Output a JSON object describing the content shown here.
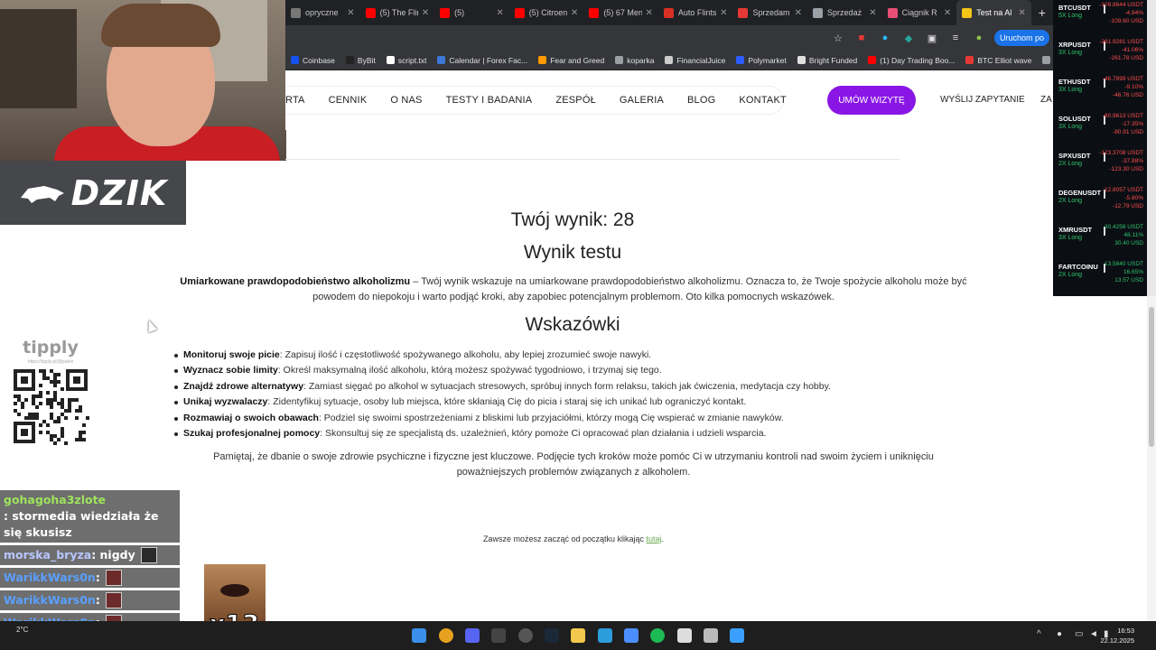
{
  "browser": {
    "tabs": [
      {
        "label": "opryczne",
        "color": "#777777"
      },
      {
        "label": "(5) The Flin",
        "color": "#ff0000"
      },
      {
        "label": "(5)",
        "color": "#ff0000"
      },
      {
        "label": "(5) Citroen",
        "color": "#ff0000"
      },
      {
        "label": "(5) 67 Men",
        "color": "#ff0000"
      },
      {
        "label": "Auto Flints",
        "color": "#d93025"
      },
      {
        "label": "Sprzedam",
        "color": "#e53935"
      },
      {
        "label": "Sprzedaż",
        "color": "#9aa0a6"
      },
      {
        "label": "Ciągnik R",
        "color": "#e94e77"
      },
      {
        "label": "Test na Al",
        "color": "#f5c518"
      }
    ],
    "active_tab_index": 9,
    "new_tab": "+",
    "launch_button": "Uruchom po",
    "bookmarks": [
      {
        "label": "Coinbase",
        "color": "#1652f0"
      },
      {
        "label": "ByBit",
        "color": "#222222"
      },
      {
        "label": "script.txt",
        "color": "#ffffff"
      },
      {
        "label": "Calendar | Forex Fac...",
        "color": "#3c78d8"
      },
      {
        "label": "Fear and Greed",
        "color": "#ff9900"
      },
      {
        "label": "koparka",
        "color": "#9aa0a6"
      },
      {
        "label": "FinancialJuice",
        "color": "#cccccc"
      },
      {
        "label": "Polymarket",
        "color": "#2d5bff"
      },
      {
        "label": "Bright Funded",
        "color": "#e0e0e0"
      },
      {
        "label": "(1) Day Trading Boo...",
        "color": "#ff0000"
      },
      {
        "label": "BTC Elliot wave",
        "color": "#e53935"
      },
      {
        "label": "palcówka",
        "color": "#9aa0a6"
      }
    ]
  },
  "site": {
    "nav": [
      "RTA",
      "CENNIK",
      "O NAS",
      "TESTY I BADANIA",
      "ZESPÓŁ",
      "GALERIA",
      "BLOG",
      "KONTAKT"
    ],
    "cta": "UMÓW WIZYTĘ",
    "send_inquiry": "WYŚLIJ ZAPYTANIE",
    "cut_link": "ZA",
    "accent": "#8a16e6"
  },
  "result": {
    "score": "Twój wynik: 28",
    "heading": "Wynik testu",
    "label": "Umiarkowane prawdopodobieństwo alkoholizmu",
    "description": " – Twój wynik wskazuje na umiarkowane prawdopodobieństwo alkoholizmu. Oznacza to, że Twoje spożycie alkoholu może być powodem do niepokoju i warto podjąć kroki, aby zapobiec potencjalnym problemom. Oto kilka pomocnych wskazówek.",
    "tips_heading": "Wskazówki",
    "tips": [
      {
        "title": "Monitoruj swoje picie",
        "text": ": Zapisuj ilość i częstotliwość spożywanego alkoholu, aby lepiej zrozumieć swoje nawyki."
      },
      {
        "title": "Wyznacz sobie limity",
        "text": ": Określ maksymalną ilość alkoholu, którą możesz spożywać tygodniowo, i trzymaj się tego."
      },
      {
        "title": "Znajdź zdrowe alternatywy",
        "text": ": Zamiast sięgać po alkohol w sytuacjach stresowych, spróbuj innych form relaksu, takich jak ćwiczenia, medytacja czy hobby."
      },
      {
        "title": "Unikaj wyzwalaczy",
        "text": ": Zidentyfikuj sytuacje, osoby lub miejsca, które skłaniają Cię do picia i staraj się ich unikać lub ograniczyć kontakt."
      },
      {
        "title": "Rozmawiaj o swoich obawach",
        "text": ": Podziel się swoimi spostrzeżeniami z bliskimi lub przyjaciółmi, którzy mogą Cię wspierać w zmianie nawyków."
      },
      {
        "title": "Szukaj profesjonalnej pomocy",
        "text": ": Skonsultuj się ze specjalistą ds. uzależnień, który pomoże Ci opracować plan działania i udzieli wsparcia."
      }
    ],
    "closing": "Pamiętaj, że dbanie o swoje zdrowie psychiczne i fizyczne jest kluczowe. Podjęcie tych kroków może pomóc Ci w utrzymaniu kontroli nad swoim życiem i uniknięciu poważniejszych problemów związanych z alkoholem.",
    "restart_prefix": "Zawsze możesz zacząć od początku klikając ",
    "restart_link": "tutaj",
    "restart_suffix": "."
  },
  "overlay": {
    "logo": "DZIK",
    "tipply": "tipply",
    "tipply_url": "https://tipply.pl/@patrix",
    "chat": [
      {
        "user": "gohagoha3zlote",
        "msg": " : stormedia wiedziała że się skusisz",
        "style": "u1",
        "emote": false
      },
      {
        "user": "morska_bryza",
        "msg": " : nigdy",
        "style": "u2",
        "emote": true
      },
      {
        "user": "WarikkWars0n",
        "msg": " :",
        "style": "u3",
        "emote": true
      },
      {
        "user": "WarikkWars0n",
        "msg": " :",
        "style": "u3",
        "emote": true
      },
      {
        "user": "WarikkWars0n",
        "msg": " :",
        "style": "u3",
        "emote": true
      },
      {
        "user": "WarikkWars0n",
        "msg": " :",
        "style": "u3",
        "emote": true
      }
    ],
    "combo": "x13"
  },
  "tickers": [
    {
      "symbol": "BTCUSDT",
      "leverage": "5X Long",
      "values": [
        "-109.8644 USDT",
        "-4.94%",
        "-109.60 USD"
      ]
    },
    {
      "symbol": "XRPUSDT",
      "leverage": "3X Long",
      "values": [
        "-261.9281 USDT",
        "-41.06%",
        "-261.78 USD"
      ]
    },
    {
      "symbol": "ETHUSDT",
      "leverage": "3X Long",
      "values": [
        "-46.7899 USDT",
        "-9.10%",
        "-46.76 USD"
      ]
    },
    {
      "symbol": "SOLUSDT",
      "leverage": "3X Long",
      "values": [
        "-80.9613 USDT",
        "-17.35%",
        "-80.91 USD"
      ]
    },
    {
      "symbol": "SPXUSDT",
      "leverage": "2X Long",
      "values": [
        "-123.3708 USDT",
        "-37.88%",
        "-123.30 USD"
      ]
    },
    {
      "symbol": "DEGENUSDT",
      "leverage": "2X Long",
      "values": [
        "-12.8057 USDT",
        "-5.80%",
        "-12.79 USD"
      ]
    },
    {
      "symbol": "XMRUSDT",
      "leverage": "3X Long",
      "values": [
        "30.4258 USDT",
        "48.11%",
        "30.40 USD"
      ]
    },
    {
      "symbol": "FARTCOINU",
      "leverage": "2X Long",
      "values": [
        "13.5840 USDT",
        "16.65%",
        "13.57 USD"
      ]
    }
  ],
  "taskbar": {
    "weather": "2°C",
    "time": "16:53",
    "date": "22.12.2025",
    "tray_arrow": "^"
  }
}
